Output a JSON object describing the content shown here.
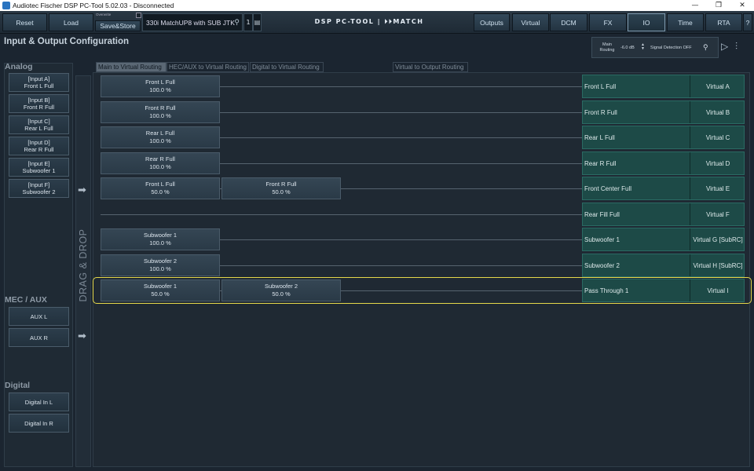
{
  "window": {
    "title": "Audiotec Fischer DSP PC-Tool 5.02.03 - Disconnected",
    "min": "—",
    "restore": "❐",
    "close": "✕"
  },
  "toolbar": {
    "reset": "Reset",
    "load": "Load",
    "overwrite": "Overwrite",
    "save_store": "Save&Store",
    "setup_name": "330i MatchUP8 with SUB JTK",
    "setup_number": "1",
    "brand": "DSP PC-TOOL | ⏵⏵MATCH",
    "nav": [
      "Outputs",
      "Virtual",
      "DCM",
      "FX",
      "IO",
      "Time",
      "RTA"
    ],
    "active_nav": "IO",
    "help": "?"
  },
  "header": {
    "title": "Input & Output Configuration",
    "main_routing_label": "Main Routing",
    "main_routing_db": "-6.0 dB",
    "signal_detection": "Signal Detection OFF"
  },
  "left": {
    "analog_label": "Analog",
    "analog_inputs": [
      {
        "line1": "[Input A]",
        "line2": "Front L Full"
      },
      {
        "line1": "[Input B]",
        "line2": "Front R Full"
      },
      {
        "line1": "[Input C]",
        "line2": "Rear L Full"
      },
      {
        "line1": "[Input D]",
        "line2": "Rear R Full"
      },
      {
        "line1": "[Input E]",
        "line2": "Subwoofer 1"
      },
      {
        "line1": "[Input F]",
        "line2": "Subwoofer 2"
      }
    ],
    "mec_label": "MEC / AUX",
    "mec_inputs": [
      "AUX L",
      "AUX R"
    ],
    "digital_label": "Digital",
    "digital_inputs": [
      "Digital In L",
      "Digital In R"
    ],
    "drag_drop": "DRAG & DROP"
  },
  "tabs": [
    "Main to Virtual Routing",
    "HEC/AUX to Virtual Routing",
    "Digital to Virtual Routing",
    "Virtual to Output Routing"
  ],
  "active_tab": "Main to Virtual Routing",
  "routing": [
    {
      "sources": [
        {
          "name": "Front L Full",
          "level": "100.0 %"
        }
      ],
      "output": "Front L Full",
      "virtual": "Virtual A"
    },
    {
      "sources": [
        {
          "name": "Front R Full",
          "level": "100.0 %"
        }
      ],
      "output": "Front R Full",
      "virtual": "Virtual B"
    },
    {
      "sources": [
        {
          "name": "Rear L Full",
          "level": "100.0 %"
        }
      ],
      "output": "Rear L Full",
      "virtual": "Virtual C"
    },
    {
      "sources": [
        {
          "name": "Rear R Full",
          "level": "100.0 %"
        }
      ],
      "output": "Rear R Full",
      "virtual": "Virtual D"
    },
    {
      "sources": [
        {
          "name": "Front L Full",
          "level": "50.0 %"
        },
        {
          "name": "Front R Full",
          "level": "50.0 %"
        }
      ],
      "output": "Front Center Full",
      "virtual": "Virtual E"
    },
    {
      "sources": [],
      "output": "Rear Fill Full",
      "virtual": "Virtual F"
    },
    {
      "sources": [
        {
          "name": "Subwoofer 1",
          "level": "100.0 %"
        }
      ],
      "output": "Subwoofer 1",
      "virtual": "Virtual G [SubRC]"
    },
    {
      "sources": [
        {
          "name": "Subwoofer 2",
          "level": "100.0 %"
        }
      ],
      "output": "Subwoofer 2",
      "virtual": "Virtual H [SubRC]"
    },
    {
      "sources": [
        {
          "name": "Subwoofer 1",
          "level": "50.0 %"
        },
        {
          "name": "Subwoofer 2",
          "level": "50.0 %"
        }
      ],
      "output": "Pass Through 1",
      "virtual": "Virtual I"
    }
  ],
  "selected_row": 8,
  "colors": {
    "output_tile": "#1d4a47",
    "selection": "#e5d84a",
    "background": "#1b2530"
  }
}
